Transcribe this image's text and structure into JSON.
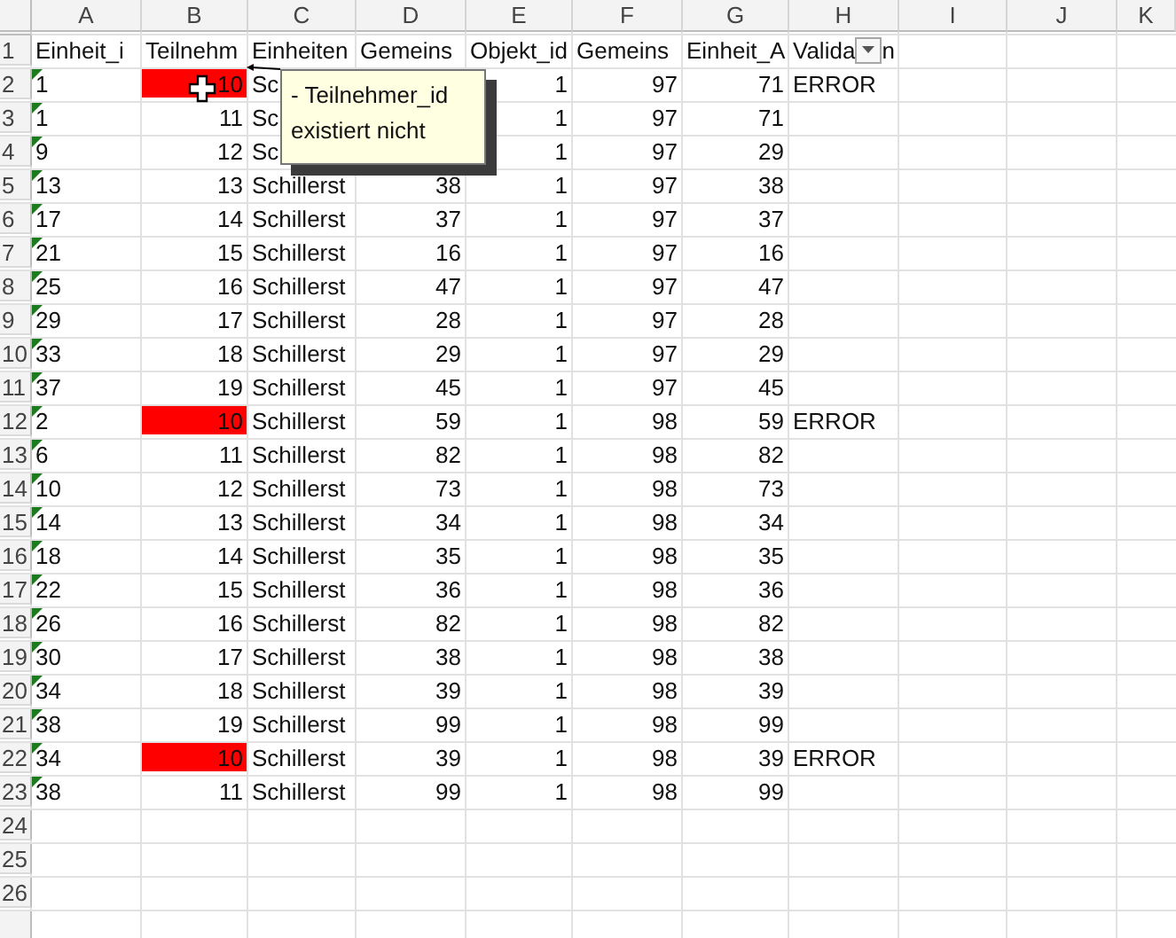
{
  "columns": [
    "A",
    "B",
    "C",
    "D",
    "E",
    "F",
    "G",
    "H",
    "I",
    "J",
    "K"
  ],
  "header_row": {
    "number": "1",
    "cells": [
      "Einheit_i",
      "Teilnehm",
      "Einheiten",
      "Gemeins",
      "Objekt_id",
      "Gemeins",
      "Einheit_A"
    ],
    "filter_label_before": "Valida",
    "filter_label_after": "n"
  },
  "rows": [
    {
      "number": "2",
      "cells": [
        "1",
        "10",
        "Sc",
        null,
        "1",
        "97",
        "71",
        "ERROR"
      ],
      "text_warning": true,
      "error": true
    },
    {
      "number": "3",
      "cells": [
        "1",
        "11",
        "Sc",
        null,
        "1",
        "97",
        "71",
        null
      ],
      "text_warning": true,
      "error": false
    },
    {
      "number": "4",
      "cells": [
        "9",
        "12",
        "Sc",
        null,
        "1",
        "97",
        "29",
        null
      ],
      "text_warning": true,
      "error": false
    },
    {
      "number": "5",
      "cells": [
        "13",
        "13",
        "Schillerst",
        "38",
        "1",
        "97",
        "38",
        null
      ],
      "text_warning": true,
      "error": false
    },
    {
      "number": "6",
      "cells": [
        "17",
        "14",
        "Schillerst",
        "37",
        "1",
        "97",
        "37",
        null
      ],
      "text_warning": true,
      "error": false
    },
    {
      "number": "7",
      "cells": [
        "21",
        "15",
        "Schillerst",
        "16",
        "1",
        "97",
        "16",
        null
      ],
      "text_warning": true,
      "error": false
    },
    {
      "number": "8",
      "cells": [
        "25",
        "16",
        "Schillerst",
        "47",
        "1",
        "97",
        "47",
        null
      ],
      "text_warning": true,
      "error": false
    },
    {
      "number": "9",
      "cells": [
        "29",
        "17",
        "Schillerst",
        "28",
        "1",
        "97",
        "28",
        null
      ],
      "text_warning": true,
      "error": false
    },
    {
      "number": "10",
      "cells": [
        "33",
        "18",
        "Schillerst",
        "29",
        "1",
        "97",
        "29",
        null
      ],
      "text_warning": true,
      "error": false
    },
    {
      "number": "11",
      "cells": [
        "37",
        "19",
        "Schillerst",
        "45",
        "1",
        "97",
        "45",
        null
      ],
      "text_warning": true,
      "error": false
    },
    {
      "number": "12",
      "cells": [
        "2",
        "10",
        "Schillerst",
        "59",
        "1",
        "98",
        "59",
        "ERROR"
      ],
      "text_warning": true,
      "error": true
    },
    {
      "number": "13",
      "cells": [
        "6",
        "11",
        "Schillerst",
        "82",
        "1",
        "98",
        "82",
        null
      ],
      "text_warning": true,
      "error": false
    },
    {
      "number": "14",
      "cells": [
        "10",
        "12",
        "Schillerst",
        "73",
        "1",
        "98",
        "73",
        null
      ],
      "text_warning": true,
      "error": false
    },
    {
      "number": "15",
      "cells": [
        "14",
        "13",
        "Schillerst",
        "34",
        "1",
        "98",
        "34",
        null
      ],
      "text_warning": true,
      "error": false
    },
    {
      "number": "16",
      "cells": [
        "18",
        "14",
        "Schillerst",
        "35",
        "1",
        "98",
        "35",
        null
      ],
      "text_warning": true,
      "error": false
    },
    {
      "number": "17",
      "cells": [
        "22",
        "15",
        "Schillerst",
        "36",
        "1",
        "98",
        "36",
        null
      ],
      "text_warning": true,
      "error": false
    },
    {
      "number": "18",
      "cells": [
        "26",
        "16",
        "Schillerst",
        "82",
        "1",
        "98",
        "82",
        null
      ],
      "text_warning": true,
      "error": false
    },
    {
      "number": "19",
      "cells": [
        "30",
        "17",
        "Schillerst",
        "38",
        "1",
        "98",
        "38",
        null
      ],
      "text_warning": true,
      "error": false
    },
    {
      "number": "20",
      "cells": [
        "34",
        "18",
        "Schillerst",
        "39",
        "1",
        "98",
        "39",
        null
      ],
      "text_warning": true,
      "error": false
    },
    {
      "number": "21",
      "cells": [
        "38",
        "19",
        "Schillerst",
        "99",
        "1",
        "98",
        "99",
        null
      ],
      "text_warning": true,
      "error": false
    },
    {
      "number": "22",
      "cells": [
        "34",
        "10",
        "Schillerst",
        "39",
        "1",
        "98",
        "39",
        "ERROR"
      ],
      "text_warning": true,
      "error": true
    },
    {
      "number": "23",
      "cells": [
        "38",
        "11",
        "Schillerst",
        "99",
        "1",
        "98",
        "99",
        null
      ],
      "text_warning": true,
      "error": false
    },
    {
      "number": "24",
      "cells": [],
      "text_warning": false,
      "error": false
    },
    {
      "number": "25",
      "cells": [],
      "text_warning": false,
      "error": false
    },
    {
      "number": "26",
      "cells": [],
      "text_warning": false,
      "error": false
    }
  ],
  "comment": {
    "text": "- Teilnehmer_id existiert nicht"
  }
}
